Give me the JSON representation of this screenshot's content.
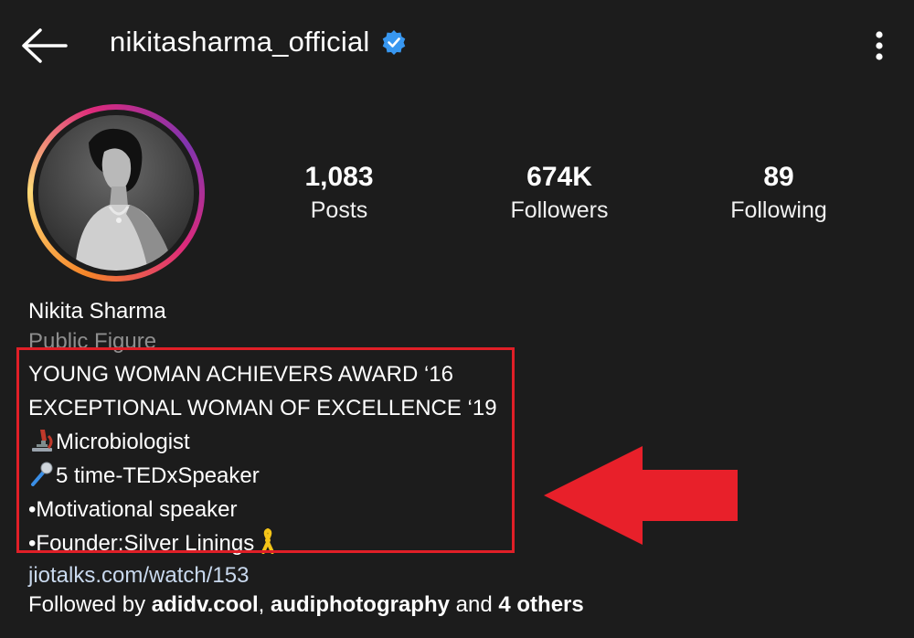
{
  "header": {
    "username": "nikitasharma_official",
    "back_icon": "back-arrow-icon",
    "verified_icon": "verified-badge-icon",
    "more_icon": "more-vertical-icon",
    "verified_color": "#3897f0"
  },
  "stats": {
    "posts": {
      "value": "1,083",
      "label": "Posts"
    },
    "followers": {
      "value": "674K",
      "label": "Followers"
    },
    "following": {
      "value": "89",
      "label": "Following"
    }
  },
  "profile": {
    "full_name": "Nikita Sharma",
    "category": "Public Figure",
    "bio_lines": [
      "YOUNG WOMAN ACHIEVERS AWARD ‘16",
      "EXCEPTIONAL WOMAN OF EXCELLENCE ‘19",
      "Microbiologist",
      "5 time-TEDxSpeaker",
      "•Motivational speaker",
      "•Founder:Silver Linings"
    ],
    "link": "jiotalks.com/watch/153",
    "followed_by": {
      "prefix": "Followed by ",
      "user1": "adidv.cool",
      "sep": ", ",
      "user2": "audiphotography",
      "and": " and ",
      "others": "4 others"
    }
  },
  "annotation": {
    "box_color": "#e01f27",
    "arrow_color": "#e01f27"
  },
  "icons": {
    "microscope": "microscope-emoji-icon",
    "microphone": "microphone-emoji-icon",
    "ribbon": "yellow-ribbon-icon"
  }
}
